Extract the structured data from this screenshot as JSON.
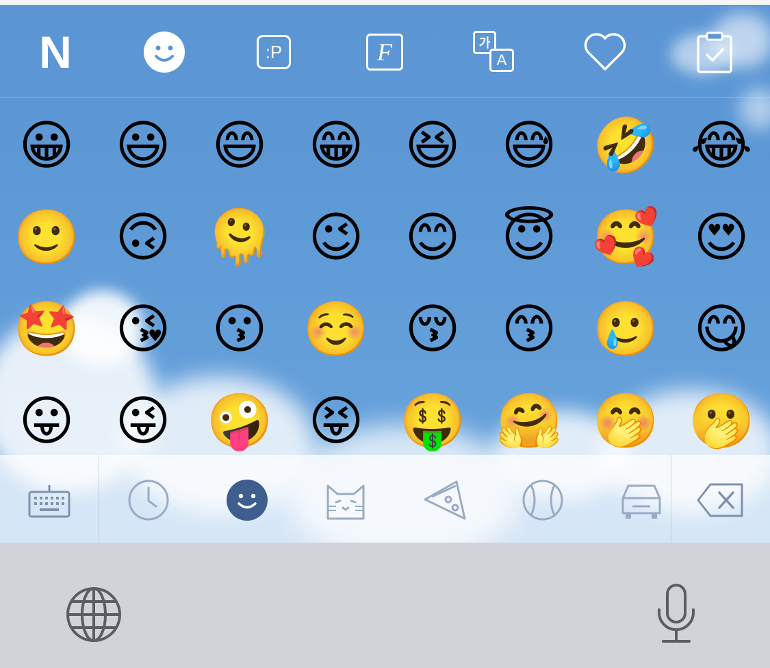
{
  "toolbar": {
    "items": [
      {
        "name": "naver-logo",
        "label": "N"
      },
      {
        "name": "emoji-mode"
      },
      {
        "name": "emoticon-mode",
        "label": ":P"
      },
      {
        "name": "font-mode",
        "label": "F"
      },
      {
        "name": "translate",
        "label_top": "가",
        "label_bottom": "A"
      },
      {
        "name": "favorites"
      },
      {
        "name": "clipboard"
      }
    ]
  },
  "emoji_grid": {
    "rows": [
      [
        "😀",
        "😃",
        "😄",
        "😁",
        "😆",
        "😅",
        "🤣",
        "😂"
      ],
      [
        "🙂",
        "🙃",
        "🫠",
        "😉",
        "😊",
        "😇",
        "🥰",
        "😍"
      ],
      [
        "🤩",
        "😘",
        "😗",
        "☺️",
        "😚",
        "😙",
        "🥲",
        "😋"
      ],
      [
        "😛",
        "😜",
        "🤪",
        "😝",
        "🤑",
        "🤗",
        "🤭",
        "🫢"
      ]
    ]
  },
  "category_bar": {
    "items": [
      "keyboard",
      "recent",
      "smileys",
      "animals",
      "food",
      "activity",
      "travel",
      "delete"
    ],
    "selected": "smileys",
    "icon_color": "#9aabc3",
    "selected_color": "#3e5f8e"
  },
  "bottom": {
    "globe": "globe",
    "mic": "microphone"
  }
}
